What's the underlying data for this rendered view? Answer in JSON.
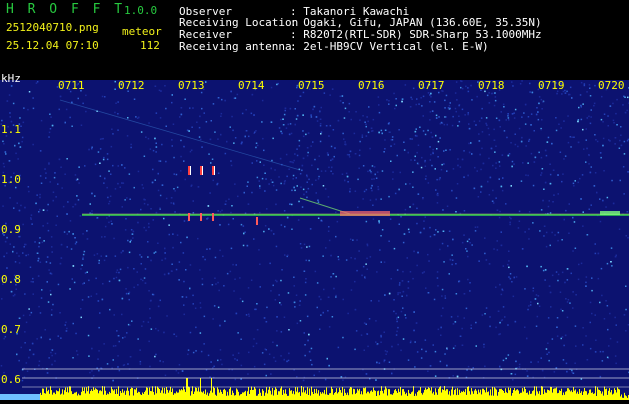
{
  "header": {
    "app_name": "H R O F F T",
    "version": "1.0.0",
    "filename": "2512040710.png",
    "datetime": "25.12.04 07:10",
    "meteor_label": "meteor",
    "meteor_count": "112",
    "observer_label": "Observer",
    "observer_value": ": Takanori Kawachi",
    "location_label": "Receiving Location",
    "location_value": ": Ogaki, Gifu, JAPAN (136.60E, 35.35N)",
    "receiver_label": "Receiver",
    "receiver_value": ": R820T2(RTL-SDR) SDR-Sharp 53.1000MHz",
    "antenna_label": "Receiving antenna",
    "antenna_value": ": 2el-HB9CV Vertical (el. E-W)"
  },
  "spectrogram": {
    "unit_label": "kHz",
    "time_ticks": [
      "0711",
      "0712",
      "0713",
      "0714",
      "0715",
      "0716",
      "0717",
      "0718",
      "0719",
      "0720"
    ],
    "freq_ticks": [
      "1.1",
      "1.0",
      "0.9",
      "0.8",
      "0.7",
      "0.6"
    ],
    "colors": {
      "background": "#0c1270",
      "header_green": "#27c93f",
      "header_yellow": "#f2f21a",
      "header_white": "#ffffff",
      "tick_yellow": "#ffff00",
      "carrier": "#33d84c",
      "bar": "#ffff00"
    }
  }
}
